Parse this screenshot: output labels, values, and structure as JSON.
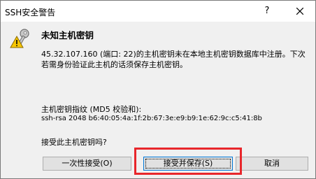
{
  "window": {
    "title": "SSH安全警告",
    "help_label": "?",
    "close_icon": "close-icon"
  },
  "dialog": {
    "icon": "key-warning-icon",
    "heading": "未知主机密钥",
    "message": "45.32.107.160 (端口: 22)的主机密钥未在本地主机密钥数据库中注册。下次若需身份验证此主机的话须保存主机密钥。",
    "fingerprint_label": "主机密钥指纹 (MD5 校验和):",
    "fingerprint_value": "ssh-rsa 2048 b6:40:05:4a:1f:2b:67:3e:e9:b9:1e:62:9c:c5:41:8b",
    "question": "接受此主机密钥吗?"
  },
  "buttons": {
    "accept_once": "一次性接受(O)",
    "accept_save": "接受并保存(S)",
    "cancel": "取消"
  },
  "colors": {
    "highlight": "#e8262b",
    "focus_border": "#0078d7"
  }
}
